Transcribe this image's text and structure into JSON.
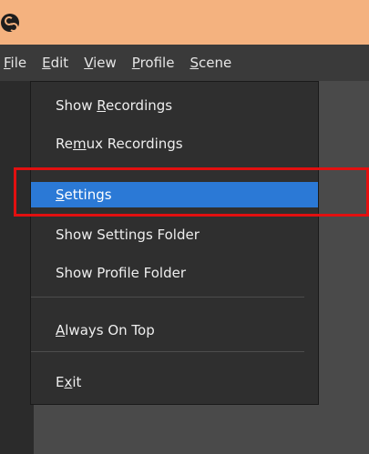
{
  "titlebar": {
    "icon": "obs-logo-icon"
  },
  "menubar": {
    "items": [
      {
        "mnemonic": "F",
        "rest": "ile"
      },
      {
        "mnemonic": "E",
        "rest": "dit"
      },
      {
        "mnemonic": "V",
        "rest": "iew"
      },
      {
        "mnemonic": "P",
        "rest": "rofile"
      },
      {
        "mnemonic": "S",
        "rest": "cene"
      }
    ]
  },
  "file_menu": {
    "show_recordings": {
      "before": "Show ",
      "mnemonic": "R",
      "after": "ecordings"
    },
    "remux_recordings": {
      "before": "Re",
      "mnemonic": "m",
      "after": "ux Recordings"
    },
    "settings": {
      "before": "",
      "mnemonic": "S",
      "after": "ettings"
    },
    "show_settings_folder": "Show Settings Folder",
    "show_profile_folder": "Show Profile Folder",
    "always_on_top": {
      "before": "",
      "mnemonic": "A",
      "after": "lways On Top"
    },
    "exit": {
      "before": "E",
      "mnemonic": "x",
      "after": "it"
    }
  },
  "colors": {
    "titlebar": "#f4b27f",
    "menu_bg": "#2f2f2f",
    "selection": "#2b79d6",
    "highlight_box": "#e21010"
  }
}
